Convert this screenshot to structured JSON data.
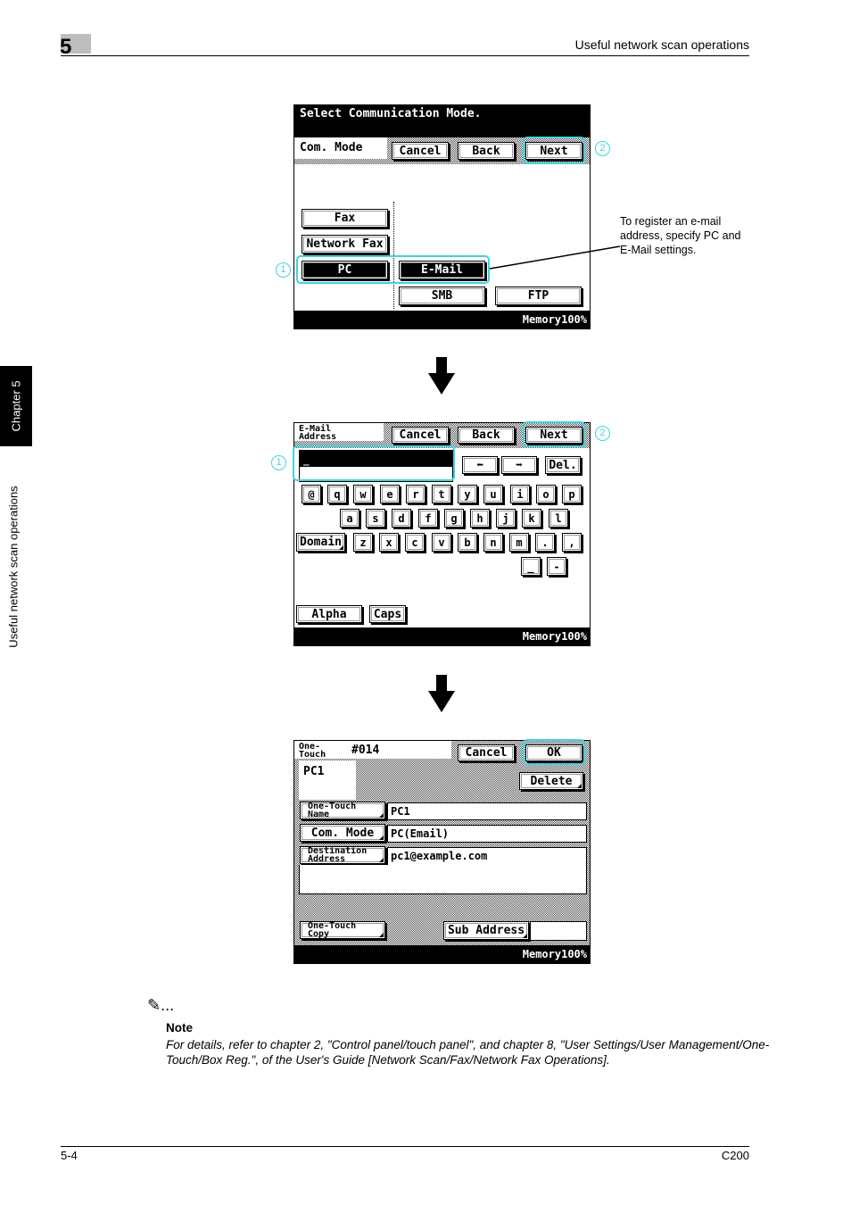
{
  "page_header": {
    "chapter_number": "5",
    "section_title": "Useful network scan operations"
  },
  "side_tabs": {
    "chapter_label": "Chapter 5",
    "section_label": "Useful network scan operations"
  },
  "screen1": {
    "title": "Select Communication Mode.",
    "mode_label": "Com. Mode",
    "buttons": {
      "cancel": "Cancel",
      "back": "Back",
      "next": "Next"
    },
    "mode_options": {
      "fax": "Fax",
      "network_fax": "Network Fax",
      "pc": "PC",
      "email": "E-Mail",
      "smb": "SMB",
      "ftp": "FTP"
    },
    "selected": [
      "PC",
      "E-Mail"
    ],
    "status": "Memory100%",
    "callouts": {
      "one": "1",
      "two": "2"
    }
  },
  "annotation": "To register an e-mail address, specify PC and E-Mail settings.",
  "screen2": {
    "field_label_line1": "E-Mail",
    "field_label_line2": "Address",
    "buttons": {
      "cancel": "Cancel",
      "back": "Back",
      "next": "Next",
      "left": "⬅",
      "right": "➡",
      "delete": "Del."
    },
    "input_value": "_",
    "keyboard": {
      "row1": [
        "@",
        "q",
        "w",
        "e",
        "r",
        "t",
        "y",
        "u",
        "i",
        "o",
        "p"
      ],
      "row2": [
        "a",
        "s",
        "d",
        "f",
        "g",
        "h",
        "j",
        "k",
        "l"
      ],
      "row3": [
        "z",
        "x",
        "c",
        "v",
        "b",
        "n",
        "m",
        ".",
        ","
      ],
      "row4": [
        "_",
        "-"
      ],
      "domain": "Domain"
    },
    "mode_buttons": {
      "alpha": "Alpha",
      "caps": "Caps"
    },
    "status": "Memory100%",
    "callouts": {
      "one": "1",
      "two": "2"
    }
  },
  "screen3": {
    "header_label_line1": "One-",
    "header_label_line2": "Touch",
    "number": "#014",
    "buttons": {
      "cancel": "Cancel",
      "ok": "OK",
      "delete": "Delete"
    },
    "preview_name": "PC1",
    "rows": [
      {
        "label_line1": "One-Touch",
        "label_line2": "Name",
        "value": "PC1"
      },
      {
        "label_line1": "Com. Mode",
        "label_line2": "",
        "value": "PC(Email)"
      },
      {
        "label_line1": "Destination",
        "label_line2": "Address",
        "value": "pc1@example.com"
      }
    ],
    "copy_button_line1": "One-Touch",
    "copy_button_line2": "Copy",
    "sub_address": "Sub Address",
    "status": "Memory100%"
  },
  "note": {
    "icon": "✎...",
    "label": "Note",
    "text": "For details, refer to chapter 2, \"Control panel/touch panel\", and chapter 8, \"User Settings/User Management/One-Touch/Box Reg.\", of the User's Guide [Network Scan/Fax/Network Fax Operations]."
  },
  "footer": {
    "page_number": "5-4",
    "model": "C200"
  },
  "colors": {
    "highlight": "#3fd3e0",
    "chapter_box": "#bdbdbd"
  }
}
